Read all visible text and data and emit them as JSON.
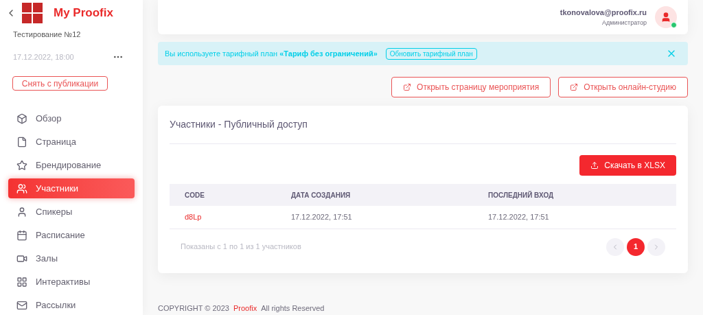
{
  "sidebar": {
    "brand": "My Proofix",
    "event_name": "Тестирование №12",
    "event_date": "17.12.2022, 18:00",
    "unpublish_button": "Снять с публикации",
    "items": [
      {
        "label": "Обзор",
        "selected": false
      },
      {
        "label": "Страница",
        "selected": false
      },
      {
        "label": "Брендирование",
        "selected": false
      },
      {
        "label": "Участники",
        "selected": true
      },
      {
        "label": "Спикеры",
        "selected": false
      },
      {
        "label": "Расписание",
        "selected": false
      },
      {
        "label": "Залы",
        "selected": false
      },
      {
        "label": "Интерактивы",
        "selected": false
      },
      {
        "label": "Рассылки",
        "selected": false
      }
    ]
  },
  "header": {
    "email": "tkonovalova@proofix.ru",
    "role": "Администратор",
    "online": true
  },
  "alert": {
    "text": "Вы используете тарифный план **«Тариф без ограничений»**",
    "button": "Обновить тарифный план"
  },
  "actions": [
    "Открыть страницу мероприятия",
    "Открыть онлайн-студию"
  ],
  "card": {
    "title": "Участники - Публичный доступ",
    "export_button": "Скачать в XLSX",
    "columns": [
      "CODE",
      "ДАТА СОЗДАНИЯ",
      "ПОСЛЕДНИЙ ВХОД"
    ],
    "rows": [
      [
        "d8Lp",
        "17.12.2022, 17:51",
        "17.12.2022, 17:51"
      ]
    ],
    "summary": "Показаны с 1 по 1 из 1 участников",
    "pages": [
      {
        "label": "1",
        "selected": true
      }
    ]
  },
  "footer": {
    "text": "COPYRIGHT © 2023",
    "link": "Proofix",
    "rest": "All rights Reserved"
  }
}
